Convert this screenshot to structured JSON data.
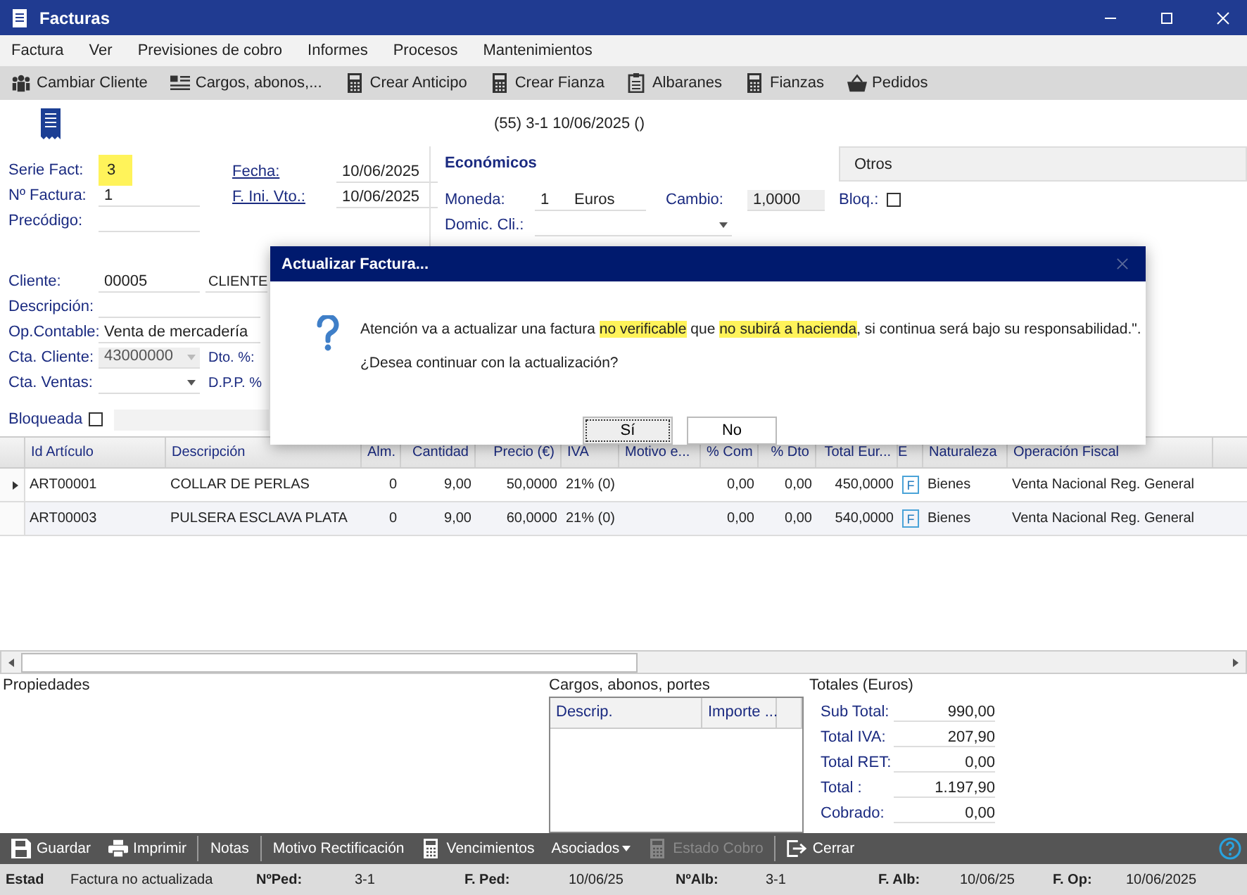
{
  "window": {
    "title": "Facturas"
  },
  "menu": [
    "Factura",
    "Ver",
    "Previsiones de cobro",
    "Informes",
    "Procesos",
    "Mantenimientos"
  ],
  "toolbar": [
    "Cambiar Cliente",
    "Cargos, abonos,...",
    "Crear Anticipo",
    "Crear Fianza",
    "Albaranes",
    "Fianzas",
    "Pedidos"
  ],
  "header": "(55) 3-1  10/06/2025  ()",
  "left_fields": [
    {
      "label": "Serie Fact:",
      "value": "3",
      "highlighted": true
    },
    {
      "label": "Nº Factura:",
      "value": "1",
      "highlighted": false
    },
    {
      "label": "Precódigo:",
      "highlighted": false
    }
  ],
  "date_fields": [
    {
      "label": "Fecha:",
      "value": "10/06/2025"
    },
    {
      "label": "F. Ini. Vto.:",
      "value": "10/06/2025"
    }
  ],
  "tabs": [
    {
      "label": "Económicos",
      "selected": true
    },
    {
      "label": "Otros",
      "selected": false
    }
  ],
  "economicos": {
    "moneda_label": "Moneda:",
    "moneda_code": "1",
    "moneda_name": "Euros",
    "cambio_label": "Cambio:",
    "cambio": "1,0000",
    "bloq_label": "Bloq.:",
    "bloq_checked": false,
    "domicilio_label": "Domic. Cli.:"
  },
  "client_fields": [
    {
      "label": "Cliente:",
      "kind": "text",
      "value": "00005",
      "extra": "CLIENTE"
    },
    {
      "label": "Descripción:",
      "kind": "text"
    },
    {
      "label": "Op.Contable:",
      "kind": "text",
      "value": "Venta de mercadería"
    },
    {
      "label": "Cta. Cliente:",
      "kind": "combo",
      "value": "43000000",
      "disabled": true,
      "side_label": "Dto. %:"
    },
    {
      "label": "Cta. Ventas:",
      "kind": "combo",
      "disabled": false,
      "side_label": "D.P.P. %"
    }
  ],
  "bloqueada": {
    "label": "Bloqueada",
    "checked": false
  },
  "dialog": {
    "title": "Actualizar Factura...",
    "message": [
      {
        "text": "Atención va a actualizar una factura ",
        "highlighted": false
      },
      {
        "text": "no verificable",
        "highlighted": true
      },
      {
        "text": " que ",
        "highlighted": false
      },
      {
        "text": "no subirá a hacienda",
        "highlighted": true
      },
      {
        "text": ", si continua será bajo su responsabilidad.\".",
        "highlighted": false
      }
    ],
    "question": "¿Desea continuar con la actualización?",
    "buttons": [
      {
        "label": "Sí",
        "focused": true
      },
      {
        "label": "No",
        "focused": false
      }
    ]
  },
  "grid": {
    "columns": [
      "Id Artículo",
      "Descripción",
      "Alm.",
      "Cantidad",
      "Precio (€)",
      "IVA",
      "Motivo e...",
      "% Com",
      "% Dto",
      "Total Eur...",
      "E",
      "Naturaleza",
      "Operación Fiscal"
    ],
    "rows": [
      {
        "current": true,
        "cells": [
          "ART00001",
          "COLLAR DE PERLAS",
          "0",
          "9,00",
          "50,0000",
          "21% (0)",
          "",
          "0,00",
          "0,00",
          "450,0000",
          "F",
          "Bienes",
          "Venta Nacional Reg. General"
        ]
      },
      {
        "current": false,
        "cells": [
          "ART00003",
          "PULSERA ESCLAVA PLATA",
          "0",
          "9,00",
          "60,0000",
          "21% (0)",
          "",
          "0,00",
          "0,00",
          "540,0000",
          "F",
          "Bienes",
          "Venta Nacional Reg. General"
        ]
      }
    ]
  },
  "properties": {
    "title": "Propiedades"
  },
  "cargos": {
    "title": "Cargos, abonos, portes",
    "columns": [
      "Descrip.",
      "Importe ..."
    ]
  },
  "totales": {
    "title": "Totales (Euros)",
    "rows": [
      {
        "label": "Sub Total:",
        "value": "990,00"
      },
      {
        "label": "Total IVA:",
        "value": "207,90"
      },
      {
        "label": "Total RET:",
        "value": "0,00"
      },
      {
        "label": "Total :",
        "value": "1.197,90"
      },
      {
        "label": "Cobrado:",
        "value": "0,00"
      }
    ]
  },
  "actions": [
    {
      "label": "Guardar",
      "disabled": false
    },
    {
      "label": "Imprimir",
      "disabled": false
    },
    {
      "label": "Notas",
      "disabled": false
    },
    {
      "label": "Motivo Rectificación",
      "disabled": false
    },
    {
      "label": "Vencimientos",
      "disabled": false
    },
    {
      "label": "Asociados",
      "disabled": false
    },
    {
      "label": "Estado Cobro",
      "disabled": true
    },
    {
      "label": "Cerrar",
      "disabled": false
    }
  ],
  "status": [
    {
      "label": "Estad",
      "value": "Factura no actualizada"
    },
    {
      "label": "NºPed:",
      "value": "3-1"
    },
    {
      "label": "F. Ped:",
      "value": "10/06/25"
    },
    {
      "label": "NºAlb:",
      "value": "3-1"
    },
    {
      "label": "F. Alb:",
      "value": "10/06/25"
    },
    {
      "label": "F. Op:",
      "value": "10/06/2025"
    }
  ]
}
